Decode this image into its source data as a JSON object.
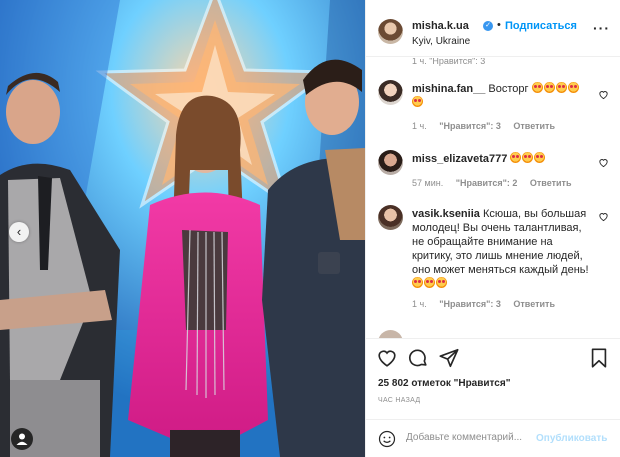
{
  "post": {
    "username": "misha.k.ua",
    "follow_label": "Подписаться",
    "separator": "•",
    "location": "Kyiv, Ukraine",
    "more_icon": "more-horizontal-icon",
    "verified_icon": "verified-badge-icon"
  },
  "comments": {
    "cut_off_text": "1 ч.   \"Нравится\": 3",
    "items": [
      {
        "username": "mishina.fan__",
        "text": "Восторг",
        "emojis": 5,
        "time": "1 ч.",
        "likes": "\"Нравится\": 3",
        "reply": "Ответить"
      },
      {
        "username": "miss_elizaveta777",
        "text": "",
        "emojis": 3,
        "time": "57 мин.",
        "likes": "\"Нравится\": 2",
        "reply": "Ответить"
      },
      {
        "username": "vasik.kseniia",
        "text": "Ксюша, вы большая молодец! Вы очень талантливая, не обращайте внимание на критику, это лишь мнение людей, оно может меняться каждый день!",
        "emojis": 3,
        "time": "1 ч.",
        "likes": "\"Нравится\": 3",
        "reply": "Ответить"
      }
    ]
  },
  "actions": {
    "icons": [
      "heart-icon",
      "comment-icon",
      "share-icon",
      "bookmark-icon"
    ],
    "likes_count": "25 802 отметок \"Нравится\"",
    "time_ago": "ЧАС НАЗАД"
  },
  "add_comment": {
    "placeholder": "Добавьте комментарий...",
    "publish_label": "Опубликовать"
  },
  "colors": {
    "accent": "#0095f6",
    "publish_disabled": "#b2dffc",
    "muted": "#8e8e8e",
    "verified": "#3897f0"
  }
}
